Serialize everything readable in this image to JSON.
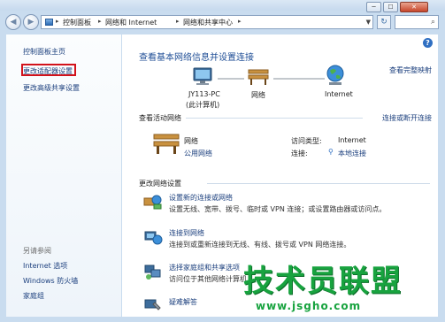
{
  "window": {
    "controls": {
      "min": "─",
      "max": "☐",
      "close": "✕"
    }
  },
  "address_bar": {
    "crumbs": [
      "控制面板",
      "网络和 Internet",
      "网络和共享中心"
    ],
    "refresh_icon": "↻",
    "search_icon": "⌕"
  },
  "left_pane": {
    "home": "控制面板主页",
    "links": [
      "更改适配器设置",
      "更改高级共享设置"
    ],
    "see_also_header": "另请参阅",
    "see_also": [
      "Internet 选项",
      "Windows 防火墙",
      "家庭组"
    ]
  },
  "main": {
    "help_icon": "?",
    "title": "查看基本网络信息并设置连接",
    "view_full_map": "查看完整映射",
    "network_map": {
      "computer": "JY113-PC",
      "computer_sub": "(此计算机)",
      "network": "网络",
      "internet": "Internet"
    },
    "active_header": "查看活动网络",
    "connect_disconnect": "连接或断开连接",
    "active_network": {
      "name": "网络",
      "type": "公用网络",
      "access_type_label": "访问类型:",
      "access_type_value": "Internet",
      "connection_label": "连接:",
      "connection_value": "本地连接"
    },
    "change_header": "更改网络设置",
    "tasks": [
      {
        "title": "设置新的连接或网络",
        "desc": "设置无线、宽带、拨号、临时或 VPN 连接；或设置路由器或访问点。"
      },
      {
        "title": "连接到网络",
        "desc": "连接到或重新连接到无线、有线、拨号或 VPN 网络连接。"
      },
      {
        "title": "选择家庭组和共享选项",
        "desc": "访问位于其他网络计算机"
      },
      {
        "title": "疑难解答",
        "desc": ""
      }
    ]
  },
  "watermark": {
    "text": "技术员联盟",
    "url": "www.jsgho.com"
  }
}
